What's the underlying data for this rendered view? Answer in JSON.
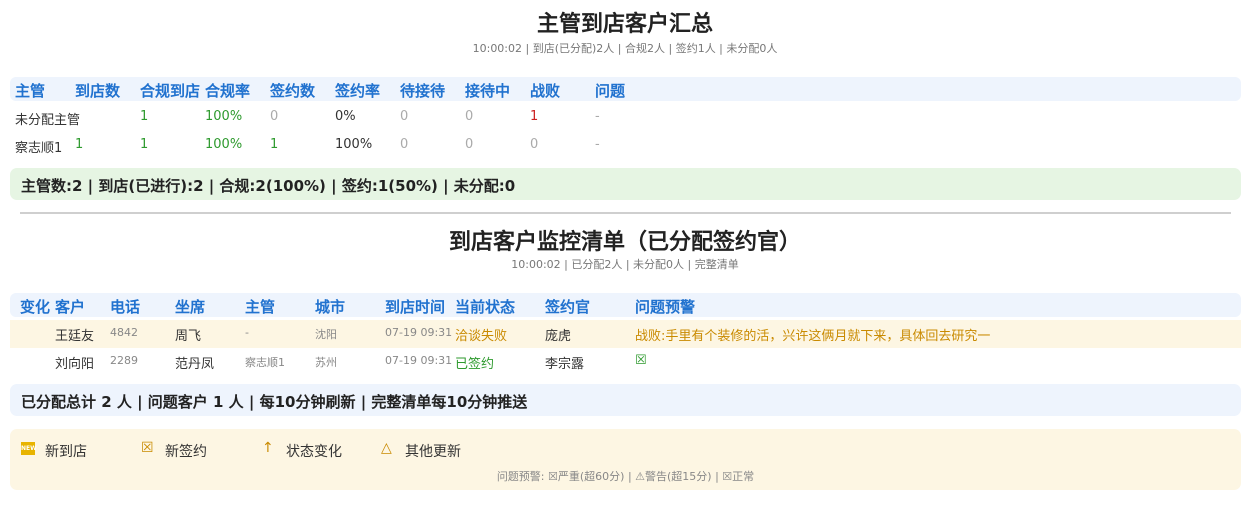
{
  "summary": {
    "title": "主管到店客户汇总",
    "subtitle": "10:00:02 | 到店(已分配)2人 | 合规2人 | 签约1人 | 未分配0人",
    "headers": [
      "主管",
      "到店数",
      "合规到店",
      "合规率",
      "签约数",
      "签约率",
      "待接待",
      "接待中",
      "战败",
      "问题"
    ],
    "rows": [
      [
        "未分配主管",
        "",
        "1",
        "100%",
        "0",
        "0%",
        "0",
        "0",
        "1",
        "-"
      ],
      [
        "察志顺1",
        "1",
        "1",
        "100%",
        "1",
        "100%",
        "0",
        "0",
        "0",
        "-"
      ]
    ],
    "footer": "主管数:2 | 到店(已进行):2 | 合规:2(100%) | 签约:1(50%) | 未分配:0"
  },
  "monitor": {
    "title": "到店客户监控清单（已分配签约官）",
    "subtitle": "10:00:02 | 已分配2人 | 未分配0人 | 完整清单",
    "headers": [
      "变化",
      "客户",
      "电话",
      "坐席",
      "主管",
      "城市",
      "到店时间",
      "当前状态",
      "签约官",
      "问题预警"
    ],
    "rows": [
      {
        "change": "",
        "customer": "王廷友",
        "phone": "4842",
        "agent": "周飞",
        "manager": "-",
        "city": "沈阳",
        "time": "07-19 09:31",
        "status": "洽谈失败",
        "signer": "庞虎",
        "warning": "战败:手里有个装修的活，兴许这俩月就下来，具体回去研究一"
      },
      {
        "change": "",
        "customer": "刘向阳",
        "phone": "2289",
        "agent": "范丹凤",
        "manager": "察志顺1",
        "city": "苏州",
        "time": "07-19 09:31",
        "status": "已签约",
        "signer": "李宗露",
        "warning": "☒"
      }
    ],
    "footer": "已分配总计 2 人 | 问题客户 1 人 | 每10分钟刷新 | 完整清单每10分钟推送"
  },
  "legend": {
    "new_badge": "NEW",
    "new_arrival": "新到店",
    "new_sign_icon": "☒",
    "new_sign": "新签约",
    "status_icon": "↑",
    "status_change": "状态变化",
    "other_icon": "△",
    "other_update": "其他更新",
    "footnote": "问题预警: ☒严重(超60分) | ⚠警告(超15分) | ☒正常"
  },
  "colors": {
    "header_bg": "#eef4fd",
    "header_text": "#2172cf",
    "green": "#2e9a2e",
    "red": "#cc2222",
    "orange": "#c98a00",
    "legend_bg": "#fdf6e3",
    "summary_bg": "#e6f5e3"
  }
}
